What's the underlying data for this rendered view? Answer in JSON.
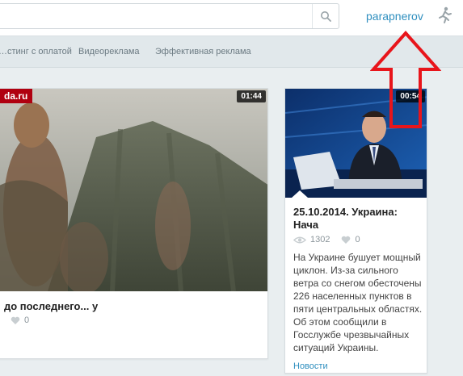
{
  "header": {
    "search_placeholder": "",
    "username": "parapnerov"
  },
  "nav": {
    "items": [
      "…стинг с оплатой",
      "Видеореклама",
      "Эффективная реклама"
    ]
  },
  "cards": [
    {
      "brand": "da.ru",
      "duration": "01:44",
      "title": "до последнего... у",
      "likes": "0"
    },
    {
      "duration": "00:54",
      "title": "25.10.2014. Украина: Нача",
      "views": "1302",
      "likes": "0",
      "description": "На Украине бушует мощный циклон. Из-за сильного ветра со снегом обесточены 226 населенных пунктов в пяти центральных областях. Об этом сообщили в Госслужбе чрезвычайных ситуаций Украины.",
      "category": "Новости"
    }
  ],
  "colors": {
    "accent": "#2f8fbf",
    "annotation_arrow": "#e8151b"
  },
  "icons": [
    "search-icon",
    "runner-icon",
    "eye-icon",
    "heart-icon"
  ]
}
